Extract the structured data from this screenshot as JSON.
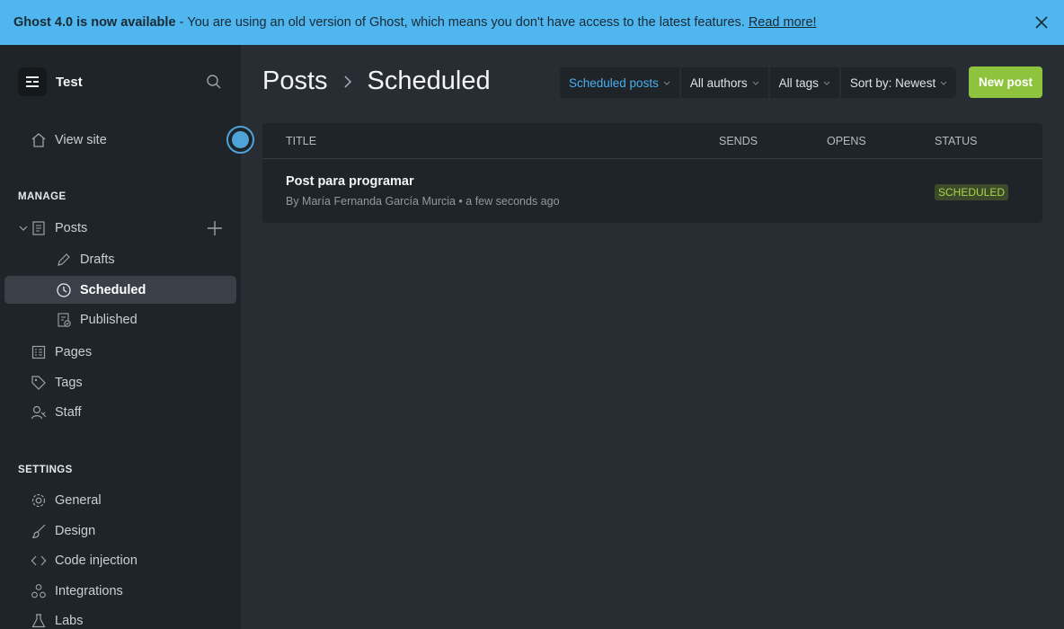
{
  "banner": {
    "headline": "Ghost 4.0 is now available",
    "separator": "-",
    "message": "You are using an old version of Ghost, which means you don't have access to the latest features.",
    "link": "Read more!",
    "close_icon": "close-icon"
  },
  "sidebar": {
    "site_name": "Test",
    "view_site": "View site",
    "manage_label": "MANAGE",
    "settings_label": "SETTINGS",
    "posts": "Posts",
    "drafts": "Drafts",
    "scheduled": "Scheduled",
    "published": "Published",
    "pages": "Pages",
    "tags": "Tags",
    "staff": "Staff",
    "general": "General",
    "design": "Design",
    "code_injection": "Code injection",
    "integrations": "Integrations",
    "labs": "Labs"
  },
  "header": {
    "crumb_root": "Posts",
    "crumb_current": "Scheduled",
    "new_post": "New post"
  },
  "filters": {
    "type": "Scheduled posts",
    "authors": "All authors",
    "tags": "All tags",
    "sort": "Sort by: Newest"
  },
  "table": {
    "columns": {
      "title": "TITLE",
      "sends": "SENDS",
      "opens": "OPENS",
      "status": "STATUS"
    },
    "rows": [
      {
        "title": "Post para programar",
        "meta": "By María Fernanda García Murcia • a few seconds ago",
        "status": "SCHEDULED"
      }
    ]
  },
  "colors": {
    "banner": "#4fb6f0",
    "sidebar": "#1f2428",
    "main": "#272d33",
    "accent_blue": "#48aff0",
    "new_post_green": "#8ec43d",
    "scheduled_badge": "#a8d54a"
  }
}
